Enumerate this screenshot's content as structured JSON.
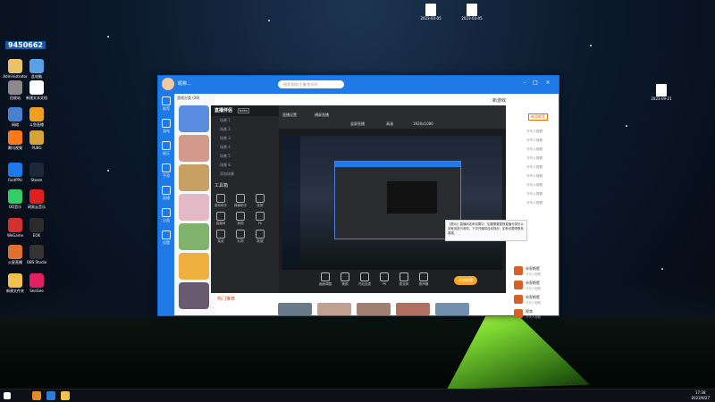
{
  "desktop": {
    "badge_number": "9450662",
    "icons": [
      {
        "label": "Administrator",
        "color": "#e9c36b"
      },
      {
        "label": "此电脑",
        "color": "#5aa0e8"
      },
      {
        "label": "回收站",
        "color": "#8a8a8a"
      },
      {
        "label": "新建文本文档",
        "color": "#ffffff"
      },
      {
        "label": "网络",
        "color": "#4a7fd0"
      },
      {
        "label": "斗鱼直播",
        "color": "#f0a020"
      },
      {
        "label": "腾讯视频",
        "color": "#ff7a1a"
      },
      {
        "label": "PUBG",
        "color": "#d8a43a"
      },
      {
        "label": "FastPPU",
        "color": "#1c7be8"
      },
      {
        "label": "Steam",
        "color": "#1b2838"
      },
      {
        "label": "QQ音乐",
        "color": "#33cc66"
      },
      {
        "label": "网易云音乐",
        "color": "#e02020"
      },
      {
        "label": "WeGame",
        "color": "#d33030"
      },
      {
        "label": "EOK",
        "color": "#2b2b2b"
      },
      {
        "label": "火星直播",
        "color": "#e07030"
      },
      {
        "label": "OBS Studio",
        "color": "#333333"
      },
      {
        "label": "新建文件夹",
        "color": "#f2c14e"
      },
      {
        "label": "SeeGee",
        "color": "#e02060"
      }
    ],
    "top_files": [
      {
        "line1": "2023-03-05",
        "line2": "17-50-13..."
      },
      {
        "line1": "2023-03-05",
        "line2": "17-44-06..."
      },
      {
        "line1": "2023-03-22",
        "line2": "19-20-57..."
      }
    ],
    "right_file": {
      "line1": "2023-09-21",
      "line2": "09-01-13..."
    }
  },
  "window": {
    "user_name": "昵称...",
    "search_placeholder": "搜索游戏/主播/房间号",
    "nav": [
      "推荐",
      "游戏",
      "娱乐",
      "手游",
      "直播",
      "分类",
      "设置"
    ],
    "games_header": "游戏分类 (20)",
    "right_header": "新游戏",
    "right_tag": "新游推荐",
    "right_rows": [
      "万代人观看",
      "万代人观看",
      "万代人观看",
      "万代人观看",
      "万代人观看",
      "万代人观看",
      "万代人观看",
      "万代人观看",
      "万代人观看"
    ],
    "right_cards": [
      {
        "title": "米家鹤壁",
        "sub": "万代人观看"
      },
      {
        "title": "米家鹤壁",
        "sub": "万代人观看"
      },
      {
        "title": "米家鹤壁",
        "sub": "万代人观看"
      },
      {
        "title": "视频",
        "sub": "万代人观看"
      }
    ],
    "bottom_header": "热门推荐"
  },
  "studio": {
    "title": "直播伴侣",
    "version": "beta",
    "scenes": [
      "场景 1",
      "场景 2",
      "场景 3",
      "场景 4",
      "场景 5",
      "场景 6",
      "添加场景"
    ],
    "tools_header": "工具箱",
    "tools": [
      "游戏助手",
      "弹幕助手",
      "录屏",
      "直播间",
      "美颜",
      "PK",
      "抽奖",
      "礼物",
      "数据"
    ],
    "tabs": [
      "直播设置",
      "横屏直播",
      "竖屏直播",
      "高清",
      "1920x1080"
    ],
    "bottom_tools": [
      "画面调整",
      "美颜",
      "开启连麦",
      "PK",
      "麦克风",
      "扬声器"
    ],
    "start_label": "开始直播",
    "tip_text": "【提示】直播间名称设置中，如果需要更换直播分类可以到首页进行修改，下次开播将自动同步；如有问题请联系客服。"
  },
  "taskbar": {
    "time": "17:38",
    "date": "2023/9/27"
  }
}
